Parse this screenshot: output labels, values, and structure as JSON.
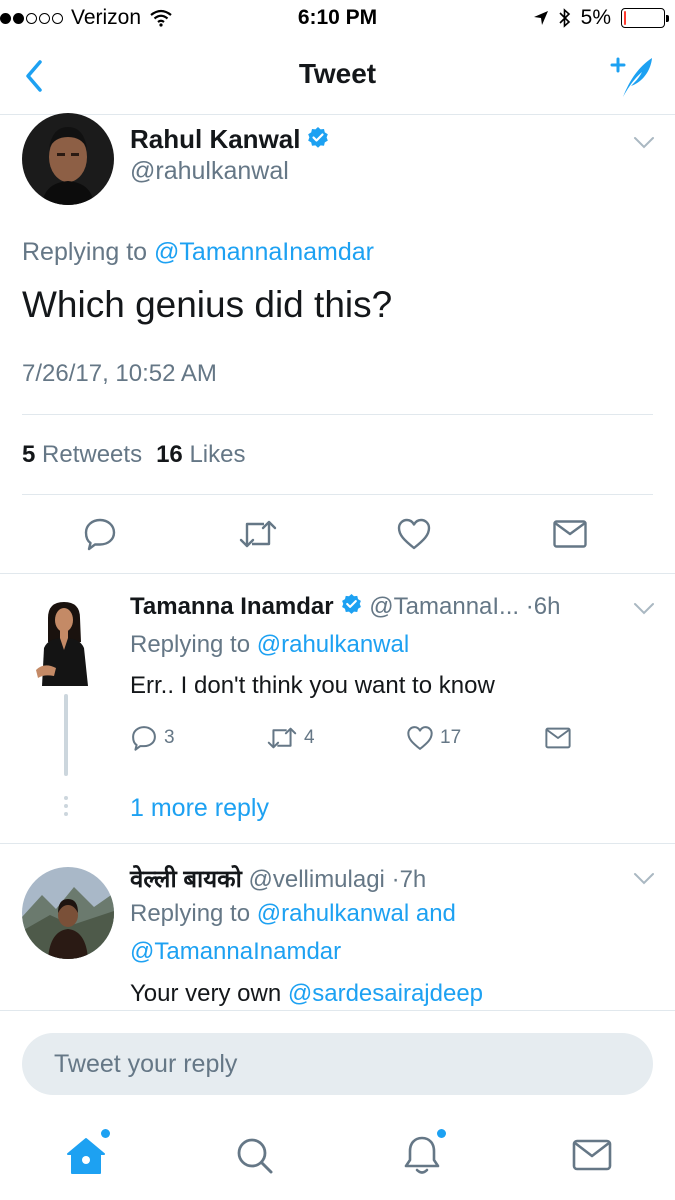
{
  "status_bar": {
    "carrier": "Verizon",
    "time": "6:10 PM",
    "battery_text": "5%",
    "battery_level": 0.05,
    "signal_full_bars": 2,
    "signal_total_bars": 5
  },
  "nav": {
    "title": "Tweet"
  },
  "main_tweet": {
    "author_name": "Rahul Kanwal",
    "author_handle": "@rahulkanwal",
    "replying_prefix": "Replying to",
    "replying_to": "@TamannaInamdar",
    "text": "Which genius did this?",
    "timestamp": "7/26/17, 10:52 AM",
    "retweets_count": "5",
    "retweets_label": "Retweets",
    "likes_count": "16",
    "likes_label": "Likes"
  },
  "replies": [
    {
      "author_name": "Tamanna Inamdar",
      "handle": "@TamannaI...",
      "time": "6h",
      "replying_prefix": "Replying to",
      "replying_to": "@rahulkanwal",
      "text": "Err.. I don't think you want to know",
      "reply_count": "3",
      "retweet_count": "4",
      "like_count": "17"
    },
    {
      "author_name": "वेल्ली बायको",
      "handle": "@vellimulagi",
      "time": "7h",
      "replying_prefix": "Replying to",
      "replying_to_1": "@rahulkanwal",
      "replying_and": "and",
      "replying_to_2": "@TamannaInamdar",
      "text_prefix": "Your very own",
      "text_mention": "@sardesairajdeep"
    }
  ],
  "more_replies_label": "1 more reply",
  "reply_box": {
    "placeholder": "Tweet your reply"
  },
  "colors": {
    "accent": "#1da1f2",
    "text": "#14171a",
    "secondary": "#657786",
    "divider": "#e1e8ed",
    "verified": "#1da1f2"
  },
  "icons": [
    "back-chevron-icon",
    "compose-tweet-icon",
    "verified-badge-icon",
    "chevron-down-icon",
    "reply-icon",
    "retweet-icon",
    "like-icon",
    "dm-icon",
    "home-icon",
    "search-icon",
    "notifications-icon",
    "messages-icon"
  ]
}
